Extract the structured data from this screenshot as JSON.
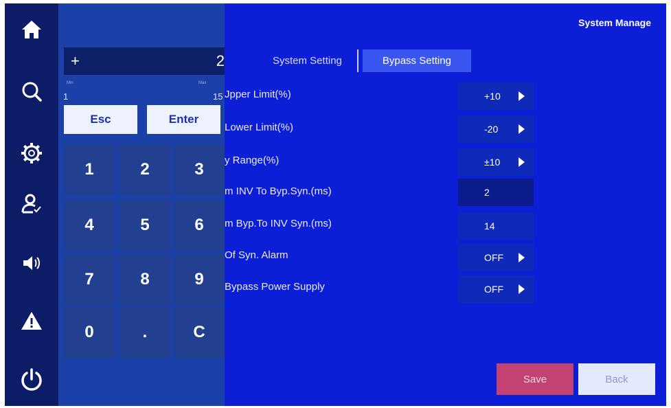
{
  "header": {
    "title": "System Manage"
  },
  "tabs": [
    {
      "label": "System Setting"
    },
    {
      "label": "Bypass Setting"
    }
  ],
  "settings": [
    {
      "label": "Jpper Limit(%)",
      "value": "+10"
    },
    {
      "label": "Lower Limit(%)",
      "value": "-20"
    },
    {
      "label": "y Range(%)",
      "value": "±10"
    },
    {
      "label": "m INV To Byp.Syn.(ms)",
      "value": "2"
    },
    {
      "label": "m Byp.To INV Syn.(ms)",
      "value": "14"
    },
    {
      "label": "Of Syn. Alarm",
      "value": "OFF"
    },
    {
      "label": "Bypass Power Supply",
      "value": "OFF"
    }
  ],
  "buttons": {
    "save": "Save",
    "back": "Back"
  },
  "keypad": {
    "sign": "+",
    "value": "2",
    "min_label": "Min",
    "max_label": "Max",
    "min": "1",
    "max": "15",
    "esc": "Esc",
    "enter": "Enter",
    "keys": [
      "1",
      "2",
      "3",
      "4",
      "5",
      "6",
      "7",
      "8",
      "9",
      "0",
      ".",
      "C"
    ]
  },
  "sidebar": {
    "icons": [
      "home-icon",
      "search-icon",
      "gear-icon",
      "user-check-icon",
      "speaker-icon",
      "warning-icon",
      "power-icon"
    ]
  },
  "colors": {
    "background": "#0d1fd6",
    "rail": "#0d1c66",
    "save": "#c24373",
    "back": "#e4e9ff"
  }
}
